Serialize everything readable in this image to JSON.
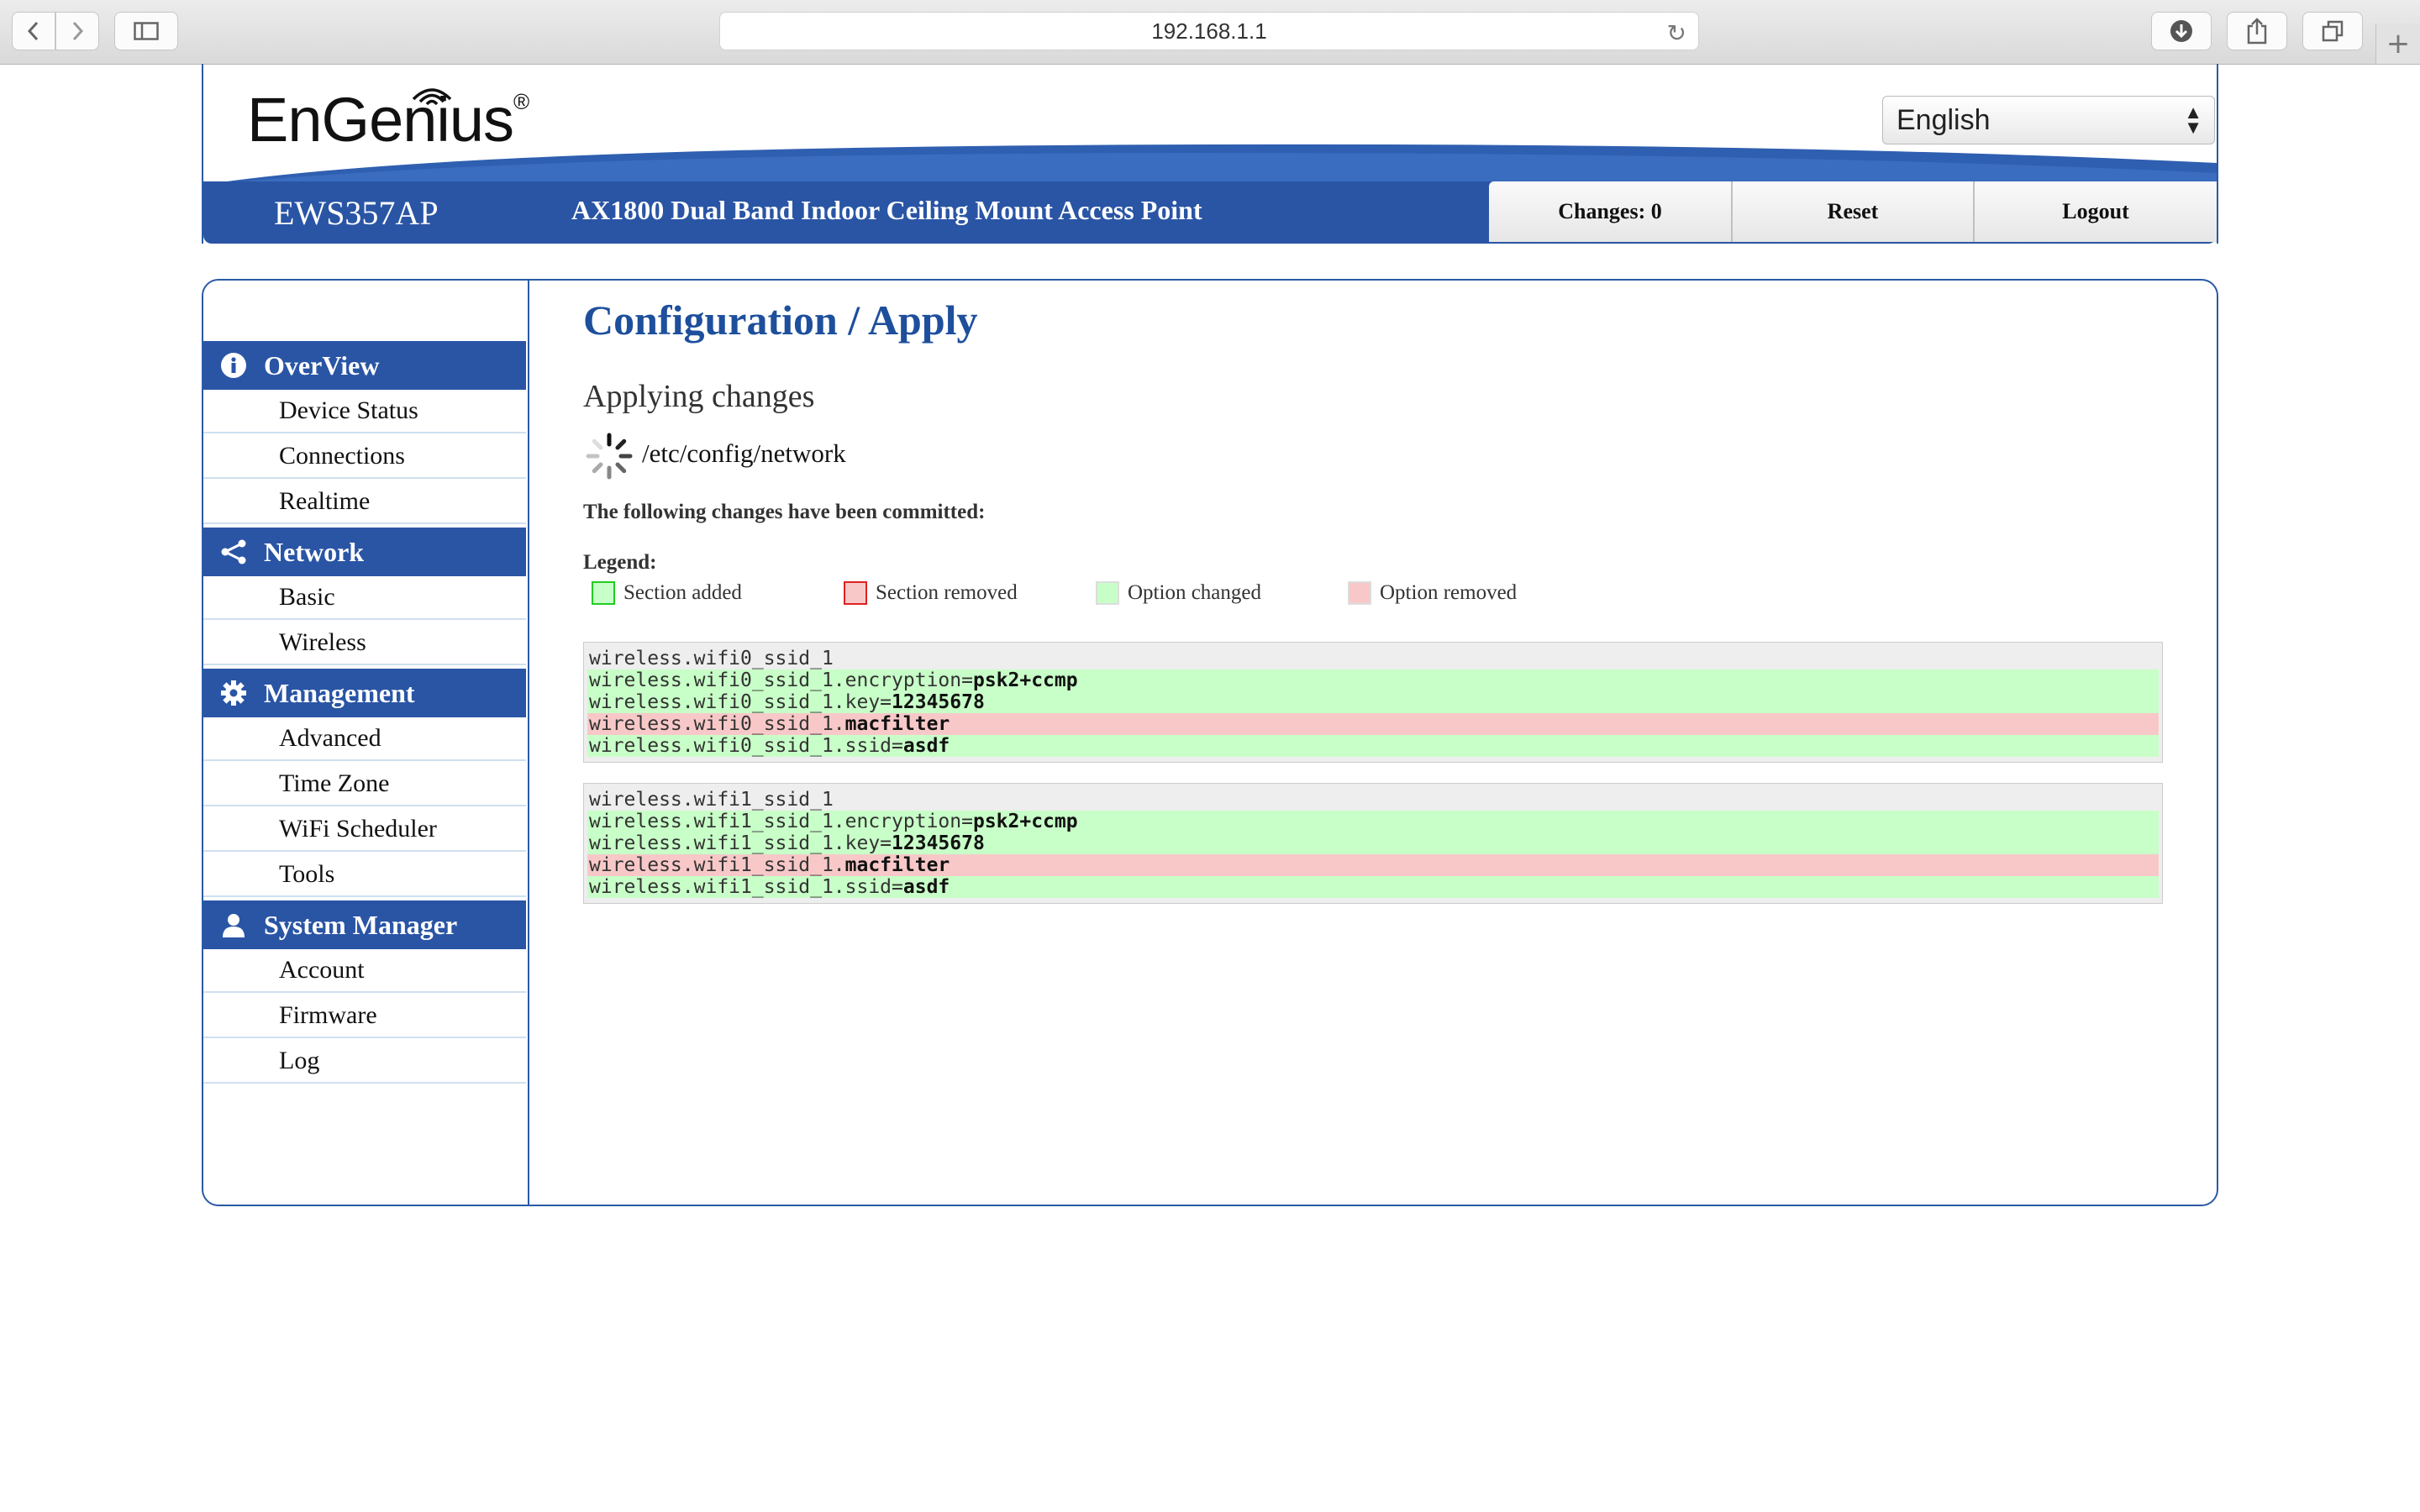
{
  "browser": {
    "url": "192.168.1.1",
    "icons": [
      "back-icon",
      "forward-icon",
      "sidebar-icon",
      "reload-icon",
      "download-icon",
      "share-icon",
      "tabs-icon",
      "new-tab-icon"
    ]
  },
  "header": {
    "logo_text": "EnGenius",
    "logo_reg": "®",
    "language": "English",
    "model": "EWS357AP",
    "model_desc": "AX1800 Dual Band Indoor Ceiling Mount Access Point",
    "changes_label": "Changes: 0",
    "reset_label": "Reset",
    "logout_label": "Logout"
  },
  "sidebar": {
    "sections": [
      {
        "label": "OverView",
        "icon": "info-icon",
        "items": [
          "Device Status",
          "Connections",
          "Realtime"
        ]
      },
      {
        "label": "Network",
        "icon": "share-network-icon",
        "items": [
          "Basic",
          "Wireless"
        ]
      },
      {
        "label": "Management",
        "icon": "gear-icon",
        "items": [
          "Advanced",
          "Time Zone",
          "WiFi Scheduler",
          "Tools"
        ]
      },
      {
        "label": "System Manager",
        "icon": "user-icon",
        "items": [
          "Account",
          "Firmware",
          "Log"
        ]
      }
    ]
  },
  "main": {
    "title": "Configuration / Apply",
    "applying": "Applying changes",
    "config_path": "/etc/config/network",
    "committed": "The following changes have been committed:",
    "legend_title": "Legend:",
    "legend": [
      {
        "label": "Section added",
        "fill": "#c8ffc8",
        "border": "#22cc22"
      },
      {
        "label": "Section removed",
        "fill": "#f8c8c8",
        "border": "#dd2222"
      },
      {
        "label": "Option changed",
        "fill": "#c8ffc8",
        "border": "#dddddd"
      },
      {
        "label": "Option removed",
        "fill": "#f8c8c8",
        "border": "#dddddd"
      }
    ],
    "diffs": [
      {
        "lines": [
          {
            "key": "wireless.wifi0_ssid_1",
            "val": "",
            "type": "section"
          },
          {
            "key": "wireless.wifi0_ssid_1.encryption=",
            "val": "psk2+ccmp",
            "type": "add"
          },
          {
            "key": "wireless.wifi0_ssid_1.key=",
            "val": "12345678",
            "type": "add"
          },
          {
            "key": "wireless.wifi0_ssid_1.",
            "val": "macfilter",
            "type": "rem"
          },
          {
            "key": "wireless.wifi0_ssid_1.ssid=",
            "val": "asdf",
            "type": "add"
          }
        ]
      },
      {
        "lines": [
          {
            "key": "wireless.wifi1_ssid_1",
            "val": "",
            "type": "section"
          },
          {
            "key": "wireless.wifi1_ssid_1.encryption=",
            "val": "psk2+ccmp",
            "type": "add"
          },
          {
            "key": "wireless.wifi1_ssid_1.key=",
            "val": "12345678",
            "type": "add"
          },
          {
            "key": "wireless.wifi1_ssid_1.",
            "val": "macfilter",
            "type": "rem"
          },
          {
            "key": "wireless.wifi1_ssid_1.ssid=",
            "val": "asdf",
            "type": "add"
          }
        ]
      }
    ]
  },
  "colors": {
    "brand_blue": "#2a55a5",
    "title_blue": "#1e4f9c"
  }
}
